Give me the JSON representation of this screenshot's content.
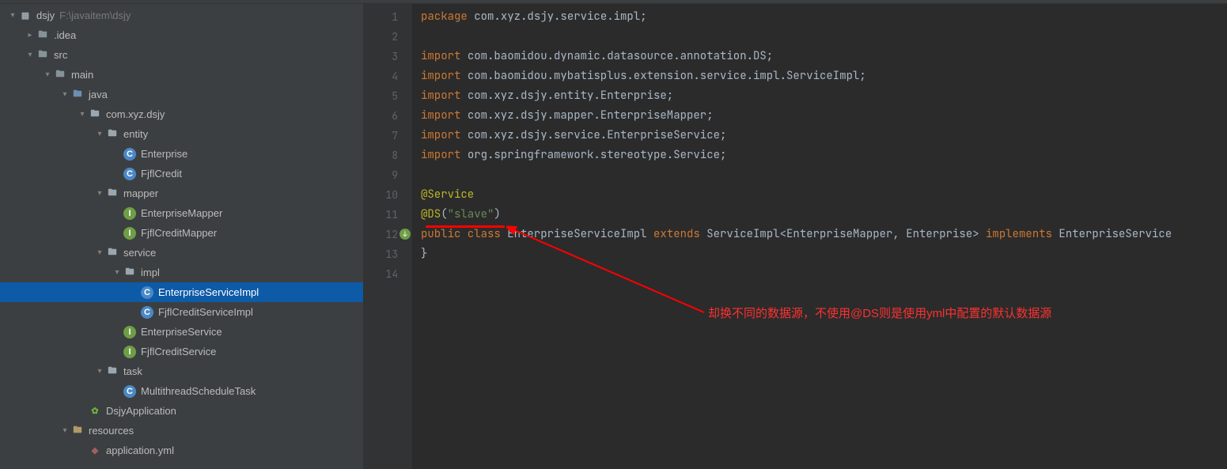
{
  "project": {
    "name": "dsjy",
    "path": "F:\\javaitem\\dsjy"
  },
  "tree": [
    {
      "depth": 0,
      "arrow": "▾",
      "iconType": "module",
      "label": "dsjy",
      "path": "F:\\javaitem\\dsjy",
      "selected": false
    },
    {
      "depth": 1,
      "arrow": "▸",
      "iconType": "folder",
      "label": ".idea",
      "selected": false
    },
    {
      "depth": 1,
      "arrow": "▾",
      "iconType": "folder",
      "label": "src",
      "selected": false
    },
    {
      "depth": 2,
      "arrow": "▾",
      "iconType": "folder",
      "label": "main",
      "selected": false
    },
    {
      "depth": 3,
      "arrow": "▾",
      "iconType": "folder-source",
      "label": "java",
      "selected": false
    },
    {
      "depth": 4,
      "arrow": "▾",
      "iconType": "package",
      "label": "com.xyz.dsjy",
      "selected": false
    },
    {
      "depth": 5,
      "arrow": "▾",
      "iconType": "package",
      "label": "entity",
      "selected": false
    },
    {
      "depth": 6,
      "arrow": "",
      "iconType": "class",
      "label": "Enterprise",
      "selected": false
    },
    {
      "depth": 6,
      "arrow": "",
      "iconType": "class",
      "label": "FjflCredit",
      "selected": false
    },
    {
      "depth": 5,
      "arrow": "▾",
      "iconType": "package",
      "label": "mapper",
      "selected": false
    },
    {
      "depth": 6,
      "arrow": "",
      "iconType": "interface",
      "label": "EnterpriseMapper",
      "selected": false
    },
    {
      "depth": 6,
      "arrow": "",
      "iconType": "interface",
      "label": "FjflCreditMapper",
      "selected": false
    },
    {
      "depth": 5,
      "arrow": "▾",
      "iconType": "package",
      "label": "service",
      "selected": false
    },
    {
      "depth": 6,
      "arrow": "▾",
      "iconType": "package",
      "label": "impl",
      "selected": false
    },
    {
      "depth": 7,
      "arrow": "",
      "iconType": "class",
      "label": "EnterpriseServiceImpl",
      "selected": true
    },
    {
      "depth": 7,
      "arrow": "",
      "iconType": "class",
      "label": "FjflCreditServiceImpl",
      "selected": false
    },
    {
      "depth": 6,
      "arrow": "",
      "iconType": "interface",
      "label": "EnterpriseService",
      "selected": false
    },
    {
      "depth": 6,
      "arrow": "",
      "iconType": "interface",
      "label": "FjflCreditService",
      "selected": false
    },
    {
      "depth": 5,
      "arrow": "▾",
      "iconType": "package",
      "label": "task",
      "selected": false
    },
    {
      "depth": 6,
      "arrow": "",
      "iconType": "class",
      "label": "MultithreadScheduleTask",
      "selected": false
    },
    {
      "depth": 4,
      "arrow": "",
      "iconType": "spring",
      "label": "DsjyApplication",
      "selected": false
    },
    {
      "depth": 3,
      "arrow": "▾",
      "iconType": "folder-resource",
      "label": "resources",
      "selected": false
    },
    {
      "depth": 4,
      "arrow": "",
      "iconType": "yml",
      "label": "application.yml",
      "selected": false
    }
  ],
  "code": {
    "lines": [
      {
        "n": 1,
        "html": "<span class='kw'>package</span> <span class='pkg'>com.xyz.dsjy.service.impl;</span>"
      },
      {
        "n": 2,
        "html": ""
      },
      {
        "n": 3,
        "html": "<span class='kw'>import</span> <span class='pkg'>com.baomidou.dynamic.datasource.annotation.DS;</span>"
      },
      {
        "n": 4,
        "html": "<span class='kw'>import</span> <span class='pkg'>com.baomidou.mybatisplus.extension.service.impl.ServiceImpl;</span>"
      },
      {
        "n": 5,
        "html": "<span class='kw'>import</span> <span class='pkg'>com.xyz.dsjy.entity.Enterprise;</span>"
      },
      {
        "n": 6,
        "html": "<span class='kw'>import</span> <span class='pkg'>com.xyz.dsjy.mapper.EnterpriseMapper;</span>"
      },
      {
        "n": 7,
        "html": "<span class='kw'>import</span> <span class='pkg'>com.xyz.dsjy.service.EnterpriseService;</span>"
      },
      {
        "n": 8,
        "html": "<span class='kw'>import</span> <span class='pkg'>org.springframework.stereotype.</span><span class='svc'>Service</span><span class='pkg'>;</span>"
      },
      {
        "n": 9,
        "html": ""
      },
      {
        "n": 10,
        "html": "<span class='ann'>@Service</span>"
      },
      {
        "n": 11,
        "html": "<span class='ann'>@DS</span>(<span class='str'>\"slave\"</span>)"
      },
      {
        "n": 12,
        "html": "<span class='kw'>public class</span> EnterpriseServiceImpl <span class='kw'>extends</span> ServiceImpl&lt;EnterpriseMapper, Enterprise&gt; <span class='kw'>implements</span> EnterpriseService"
      },
      {
        "n": 13,
        "html": "}"
      },
      {
        "n": 14,
        "html": ""
      }
    ]
  },
  "annotation": {
    "text": "却换不同的数据源，不使用@DS则是使用yml中配置的默认数据源"
  }
}
